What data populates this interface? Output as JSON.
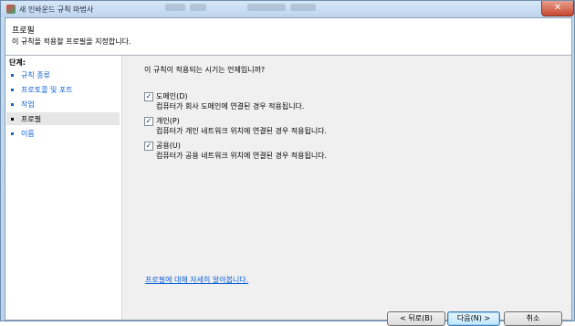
{
  "window": {
    "title": "새 인바운드 규칙 마법사"
  },
  "header": {
    "title": "프로필",
    "subtitle": "이 규칙을 적용할 프로필을 지정합니다."
  },
  "steps": {
    "heading": "단계:",
    "items": [
      {
        "label": "규칙 종류"
      },
      {
        "label": "프로토콜 및 포트"
      },
      {
        "label": "작업"
      },
      {
        "label": "프로필"
      },
      {
        "label": "이름"
      }
    ]
  },
  "main": {
    "question": "이 규칙이 적용되는 시기는 언제입니까?",
    "options": [
      {
        "name": "도메인(D)",
        "desc": "컴퓨터가 회사 도메인에 연결된 경우 적용됩니다.",
        "checked": true
      },
      {
        "name": "개인(P)",
        "desc": "컴퓨터가 개인 네트워크 위치에 연결된 경우 적용됩니다.",
        "checked": true
      },
      {
        "name": "공용(U)",
        "desc": "컴퓨터가 공용 네트워크 위치에 연결된 경우 적용됩니다.",
        "checked": true
      }
    ],
    "learn_more": "프로필에 대해 자세히 알아봅니다."
  },
  "buttons": {
    "back": "< 뒤로(B)",
    "next": "다음(N) >",
    "cancel": "취소"
  },
  "colors": {
    "link": "#0b5ed7",
    "title_bar": "#bdd4ec",
    "close": "#c6482f"
  }
}
